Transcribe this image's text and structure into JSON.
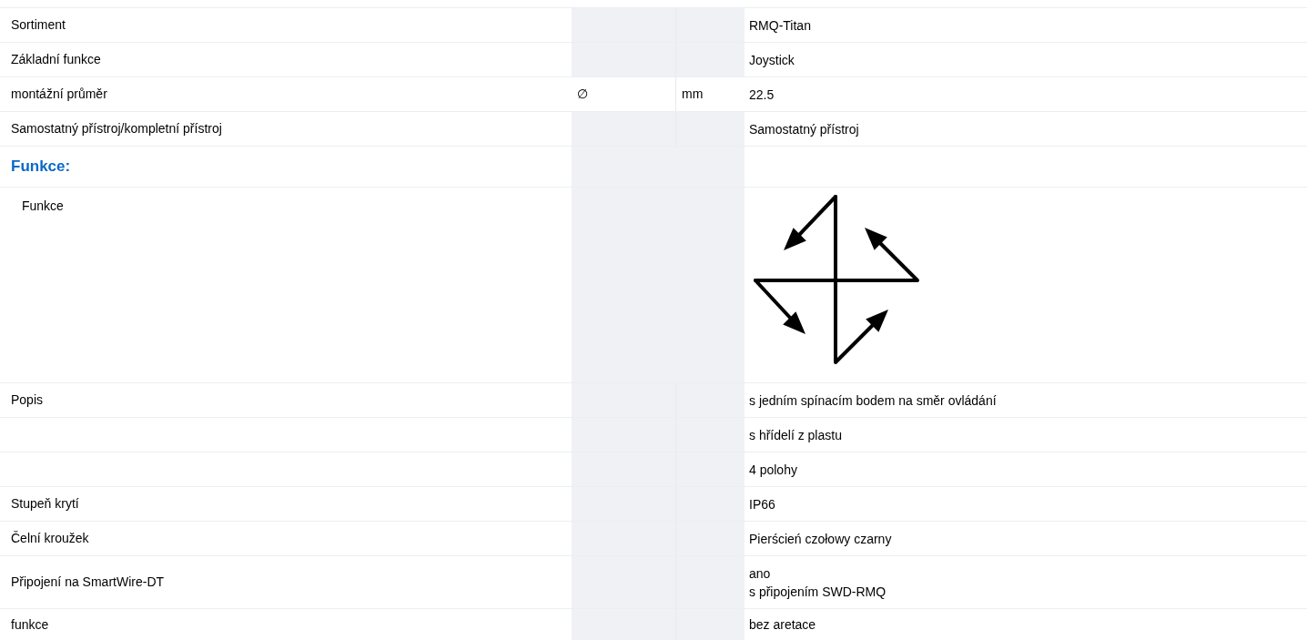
{
  "rows": [
    {
      "kind": "row",
      "label": "Sortiment",
      "values": [
        "RMQ-Titan"
      ]
    },
    {
      "kind": "row",
      "label": "Základní funkce",
      "values": [
        "Joystick"
      ]
    },
    {
      "kind": "row",
      "label": "montážní průměr",
      "symbol": "∅",
      "unit": "mm",
      "values": [
        "22.5"
      ]
    },
    {
      "kind": "row",
      "label": "Samostatný přístroj/kompletní přístroj",
      "values": [
        "Samostatný přístroj"
      ]
    },
    {
      "kind": "heading",
      "label": "Funkce:"
    },
    {
      "kind": "diagram",
      "label": "Funkce"
    },
    {
      "kind": "row",
      "label": "Popis",
      "values": [
        "s jedním spínacím bodem na směr ovládání"
      ]
    },
    {
      "kind": "row",
      "values": [
        "s hřídelí z plastu"
      ]
    },
    {
      "kind": "row",
      "values": [
        "4 polohy"
      ]
    },
    {
      "kind": "row",
      "label": "Stupeň krytí",
      "values": [
        "IP66"
      ]
    },
    {
      "kind": "row",
      "label": "Čelní kroužek",
      "values": [
        "Pierścień czołowy czarny"
      ]
    },
    {
      "kind": "row",
      "label": "Připojení na SmartWire-DT",
      "values": [
        "ano",
        "s připojením SWD-RMQ"
      ]
    },
    {
      "kind": "last",
      "label": "funkce",
      "values": [
        "bez aretace"
      ]
    }
  ]
}
